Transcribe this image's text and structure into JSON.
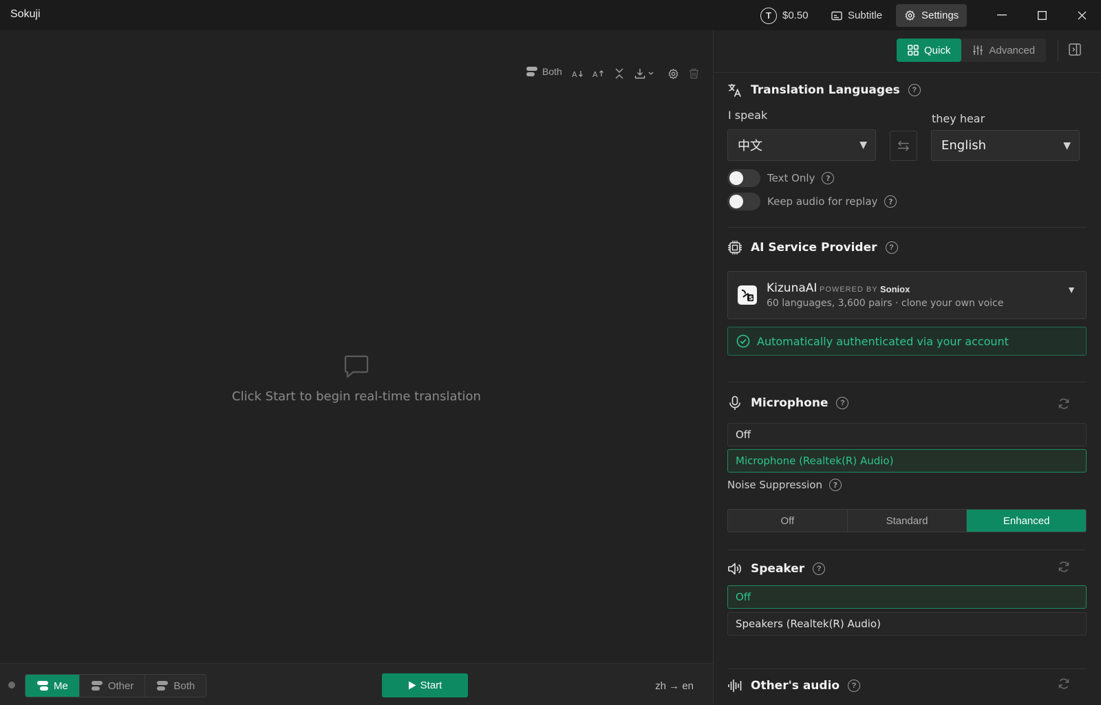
{
  "app": {
    "title": "Sokuji"
  },
  "titlebar": {
    "balance_icon": "T",
    "balance": "$0.50",
    "subtitle_label": "Subtitle",
    "settings_label": "Settings"
  },
  "toolbar": {
    "both_label": "Both"
  },
  "empty_state": {
    "text": "Click Start to begin real-time translation"
  },
  "bottombar": {
    "speaker_filter": [
      {
        "label": "Me",
        "active": true
      },
      {
        "label": "Other",
        "active": false
      },
      {
        "label": "Both",
        "active": false
      }
    ],
    "start_label": "Start",
    "language_pair": "zh → en"
  },
  "panel": {
    "modes": [
      {
        "label": "Quick",
        "active": true
      },
      {
        "label": "Advanced",
        "active": false
      }
    ],
    "translation": {
      "title": "Translation Languages",
      "source_label": "I speak",
      "source_value": "中文",
      "target_label": "they hear",
      "target_value": "English",
      "text_only_label": "Text Only",
      "text_only": false,
      "keep_audio_label": "Keep audio for replay",
      "keep_audio": false
    },
    "provider": {
      "title": "AI Service Provider",
      "name": "KizunaAI",
      "powered_by": "POWERED BY",
      "engine": "Soniox",
      "description": "60 languages, 3,600 pairs · clone your own voice",
      "auth_status": "Automatically authenticated via your account"
    },
    "microphone": {
      "title": "Microphone",
      "devices": [
        {
          "label": "Off",
          "selected": false
        },
        {
          "label": "Microphone (Realtek(R) Audio)",
          "selected": true
        }
      ],
      "noise_label": "Noise Suppression",
      "noise_options": [
        {
          "label": "Off",
          "active": false
        },
        {
          "label": "Standard",
          "active": false
        },
        {
          "label": "Enhanced",
          "active": true
        }
      ]
    },
    "speaker": {
      "title": "Speaker",
      "devices": [
        {
          "label": "Off",
          "selected": true
        },
        {
          "label": "Speakers (Realtek(R) Audio)",
          "selected": false
        }
      ]
    },
    "other_audio": {
      "title": "Other's audio"
    }
  },
  "colors": {
    "accent": "#0e8a63",
    "accent_text": "#2fc48d",
    "background": "#222222"
  }
}
